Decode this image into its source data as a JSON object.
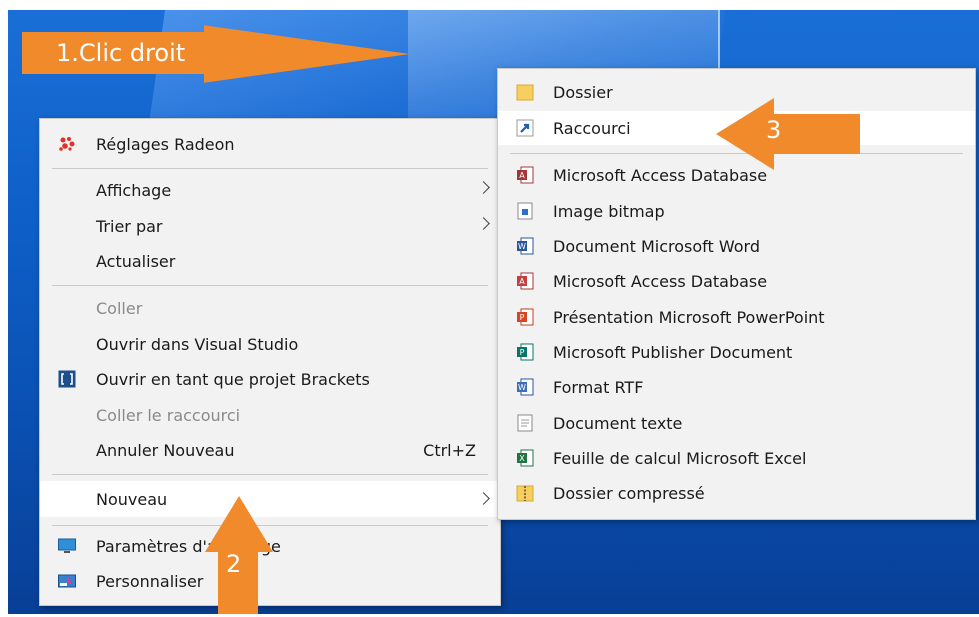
{
  "annotations": {
    "step1": "1.Clic droit",
    "step2": "2",
    "step3": "3"
  },
  "context_menu": {
    "radeon": "Réglages Radeon",
    "view": "Affichage",
    "sort_by": "Trier par",
    "refresh": "Actualiser",
    "paste": "Coller",
    "open_vs": "Ouvrir dans Visual Studio",
    "open_brackets": "Ouvrir en tant que projet Brackets",
    "paste_shortcut": "Coller le raccourci",
    "undo_new": "Annuler Nouveau",
    "undo_shortcut": "Ctrl+Z",
    "new": "Nouveau",
    "display_settings": "Paramètres d'affichage",
    "personalize": "Personnaliser"
  },
  "submenu": {
    "items": [
      {
        "label": "Dossier"
      },
      {
        "label": "Raccourci"
      },
      {
        "label": "Microsoft Access Database"
      },
      {
        "label": "Image bitmap"
      },
      {
        "label": "Document Microsoft Word"
      },
      {
        "label": "Microsoft Access Database"
      },
      {
        "label": "Présentation Microsoft PowerPoint"
      },
      {
        "label": "Microsoft Publisher Document"
      },
      {
        "label": "Format RTF"
      },
      {
        "label": "Document texte"
      },
      {
        "label": "Feuille de calcul Microsoft Excel"
      },
      {
        "label": "Dossier compressé"
      }
    ]
  },
  "colors": {
    "accent_orange": "#f08a2a",
    "desktop_blue": "#0e5fc8",
    "menu_bg": "#f2f2f2"
  }
}
